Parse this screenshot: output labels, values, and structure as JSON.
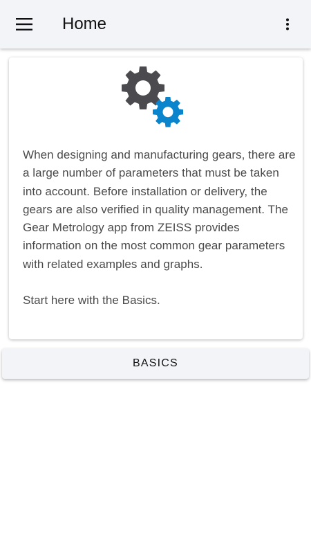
{
  "appbar": {
    "title": "Home",
    "menu_icon": "hamburger-menu-icon",
    "overflow_icon": "more-vert-icon"
  },
  "intro_card": {
    "image_icon": "gears-icon",
    "paragraph": "When designing and manufacturing gears, there are a large number of parameters that must be taken into account. Before installation or delivery, the gears are also verified in quality management. The Gear Metrology app from ZEISS provides information on the most common gear parameters with related examples and graphs.",
    "cta_text": "Start here with the Basics."
  },
  "basics_button": {
    "label": "BASICS"
  },
  "colors": {
    "appbar_bg": "#f3f4f8",
    "gear_dark": "#4a4a4f",
    "gear_accent": "#0a84cc",
    "body_text": "#4a4a4a"
  }
}
